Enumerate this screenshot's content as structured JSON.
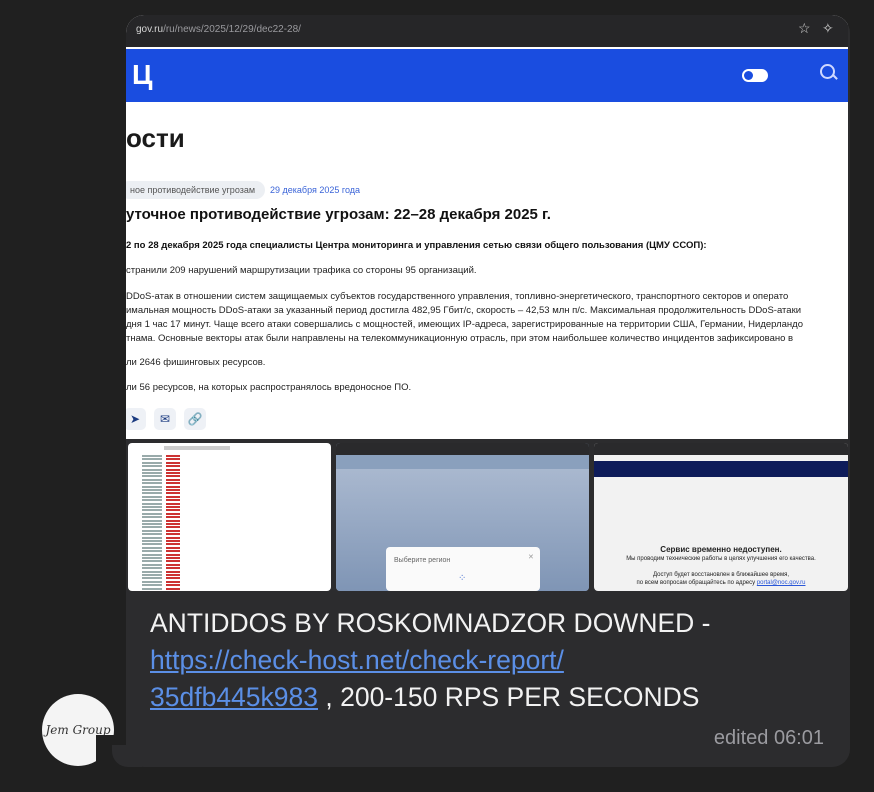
{
  "browser": {
    "url_host": "gov.ru",
    "url_path": "/ru/news/2025/12/29/dec22-28/",
    "star_icon": "star-icon",
    "extension_icon": "sparkle-icon"
  },
  "site": {
    "logo": "Ц",
    "section_title": "ости",
    "tag": "ное противодействие угрозам",
    "date": "29 декабря 2025 года",
    "article_title": "уточное противодействие угрозам: 22–28 декабря 2025 г.",
    "lead": "2 по 28 декабря 2025 года специалисты Центра мониторинга и управления сетью связи общего пользования (ЦМУ ССОП):",
    "para1": "странили 209 нарушений маршрутизации трафика со стороны 95 организаций.",
    "para2_l1": "DDoS-атак в отношении систем защищаемых субъектов государственного управления, топливно-энергетического, транспортного секторов и операто",
    "para2_l2": "имальная мощность DDoS-атаки за указанный период достигла 482,95 Гбит/с, скорость – 42,53 млн п/с. Максимальная продолжительность DDoS-атаки",
    "para2_l3": "дня 1 час 17 минут. Чаще всего атаки совершались с мощностей, имеющих IP-адреса, зарегистрированные на территории США, Германии, Нидерландо",
    "para2_l4": "тнама. Основные векторы атак были направлены на телекоммуникационную отрасль, при этом наибольшее количество инцидентов зафиксировано в",
    "para3": "ли 2646 фишинговых ресурсов.",
    "para4": "ли 56 ресурсов, на которых распространялось вредоносное ПО."
  },
  "thumbs": {
    "region_modal_title": "Выберите регион",
    "outage_title": "Сервис временно недоступен.",
    "outage_line1": "Мы проводим технические работы в целях улучшения его качества.",
    "outage_line2": "Доступ будет восстановлен в ближайшее время,",
    "outage_line3": "по всем вопросам обращайтесь по адресу",
    "outage_email": "portal@noc.gov.ru"
  },
  "message": {
    "text_before": "ANTIDDOS BY ROSKOMNADZOR DOWNED - ",
    "link": "https://check-host.net/check-report/35dfb445k983",
    "link_line1": "https://check-host.net/check-report/",
    "link_line2": "35dfb445k983",
    "text_after": " , 200-150 RPS PER SECONDS",
    "edited": "edited 06:01"
  },
  "avatar": {
    "label": "Jem Group"
  },
  "colors": {
    "background": "#202020",
    "bubble": "#2c2c2e",
    "link": "#5b8fe6",
    "site_header": "#1a4de0"
  }
}
